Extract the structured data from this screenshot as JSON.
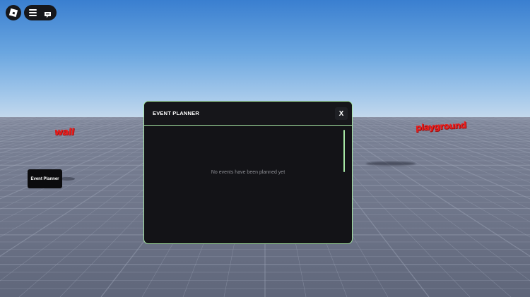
{
  "world": {
    "sign_wall": "wall",
    "sign_playground": "playground",
    "sky_color_top": "#3a7fd0",
    "ground_color": "#6e7589",
    "sign_color": "#e8201f"
  },
  "topbar": {
    "logo_icon": "roblox-logo-icon",
    "menu_icon": "hamburger-menu-icon",
    "chat_icon": "chat-bubble-icon"
  },
  "side_button": {
    "label": "Event Planner"
  },
  "dialog": {
    "title": "EVENT PLANNER",
    "close_label": "X",
    "empty_message": "No events have been planned yet",
    "accent_color": "#a6e6a4",
    "background_color": "#131317"
  }
}
